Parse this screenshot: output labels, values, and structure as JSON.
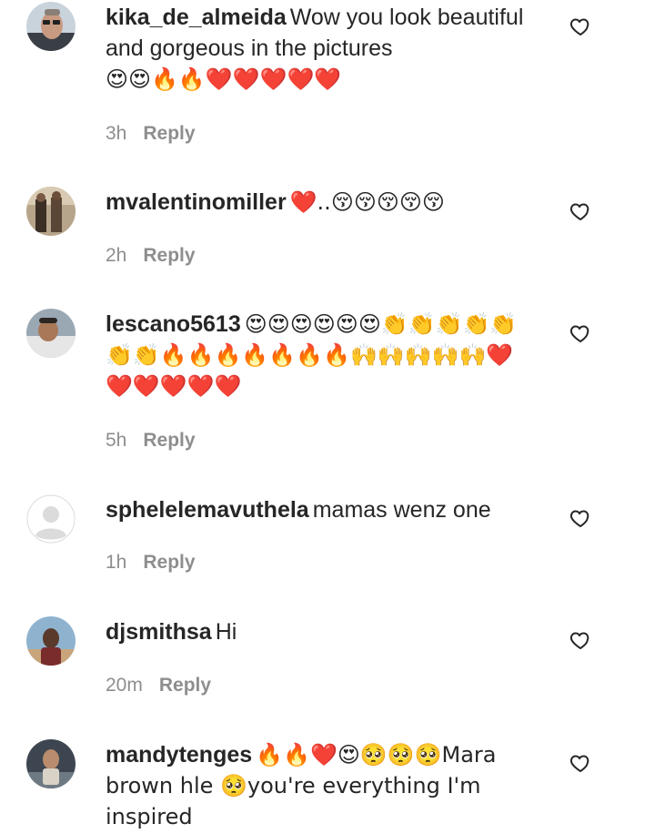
{
  "comments": [
    {
      "username": "kika_de_almeida",
      "text": "Wow you look beautiful and gorgeous in the pictures",
      "emojis": "😍😍🔥🔥❤️❤️❤️❤️❤️",
      "trailing_text": "",
      "time": "3h",
      "reply_label": "Reply"
    },
    {
      "username": "mvalentinomiller",
      "text": "❤️..😚😚😚😚😚",
      "emojis": "",
      "trailing_text": "",
      "time": "2h",
      "reply_label": "Reply"
    },
    {
      "username": "lescano5613",
      "text": "😍😍😍😍😍😍👏👏👏👏👏👏👏🔥🔥🔥🔥🔥🔥🔥🙌🙌🙌🙌🙌❤️❤️❤️❤️❤️❤️",
      "emojis": "",
      "trailing_text": "",
      "time": "5h",
      "reply_label": "Reply"
    },
    {
      "username": "sphelelemavuthela",
      "text": "mamas wenz one",
      "emojis": "",
      "trailing_text": "",
      "time": "1h",
      "reply_label": "Reply"
    },
    {
      "username": "djsmithsa",
      "text": "Hi",
      "emojis": "",
      "trailing_text": "",
      "time": "20m",
      "reply_label": "Reply"
    },
    {
      "username": "mandytenges",
      "text": "🔥🔥❤️😍🥺🥺🥺Mara brown hle 🥺you're everything I'm inspired",
      "emojis": "",
      "trailing_text": "",
      "time": "",
      "reply_label": ""
    }
  ],
  "icons": {
    "like": "heart-outline-icon",
    "avatar_placeholder": "default-avatar-icon"
  },
  "colors": {
    "text": "#262626",
    "meta": "#8e8e8e",
    "background": "#ffffff"
  }
}
